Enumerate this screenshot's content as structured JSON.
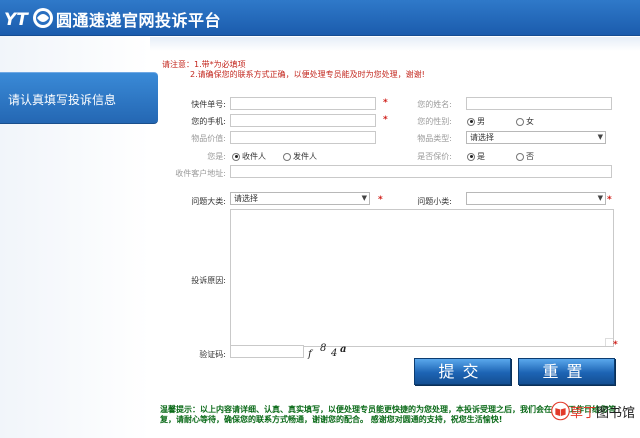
{
  "header": {
    "logo_text": "YT",
    "title": "圆通速递官网投诉平台"
  },
  "sidebar": {
    "tab_label": "请认真填写投诉信息"
  },
  "notice": {
    "line1": "请注意：1.带*为必填项",
    "line2": "2.请确保您的联系方式正确，以便处理专员能及时为您处理，谢谢!"
  },
  "form": {
    "waybill_label": "快件单号:",
    "name_label": "您的姓名:",
    "phone_label": "您的手机:",
    "gender_label": "您的性别:",
    "gender_options": [
      "男",
      "女"
    ],
    "gender_selected": "男",
    "value_label": "物品价值:",
    "item_type_label": "物品类型:",
    "item_type_value": "请选择",
    "you_are_label": "您是:",
    "you_are_options": [
      "收件人",
      "发件人"
    ],
    "you_are_selected": "收件人",
    "insured_label": "是否保价:",
    "insured_options": [
      "是",
      "否"
    ],
    "insured_selected": "是",
    "address_label": "收件客户地址:",
    "category_label": "问题大类:",
    "category_value": "请选择",
    "subcategory_label": "问题小类:",
    "subcategory_value": "",
    "reason_label": "投诉原因:",
    "captcha_label": "验证码:",
    "captcha_chars": [
      "f",
      "8",
      "4",
      "a"
    ],
    "required_mark": "*"
  },
  "buttons": {
    "submit": "提交",
    "reset": "重置"
  },
  "tips": {
    "text": "温馨提示：以上内容请详细、认真、真实填写，以便处理专员能更快捷的为您处理，本投诉受理之后，我们会在一个工作日给您答复，请耐心等待，确保您的联系方式畅通，谢谢您的配合。 感谢您对圆通的支持，祝您生活愉快!"
  },
  "watermark": {
    "red_text": "草丁",
    "dark_text": "图书馆"
  },
  "colors": {
    "header_blue": "#1b5cad",
    "required_red": "#d0201b",
    "tips_green": "#0a6a18",
    "button_blue": "#1d64b4"
  }
}
